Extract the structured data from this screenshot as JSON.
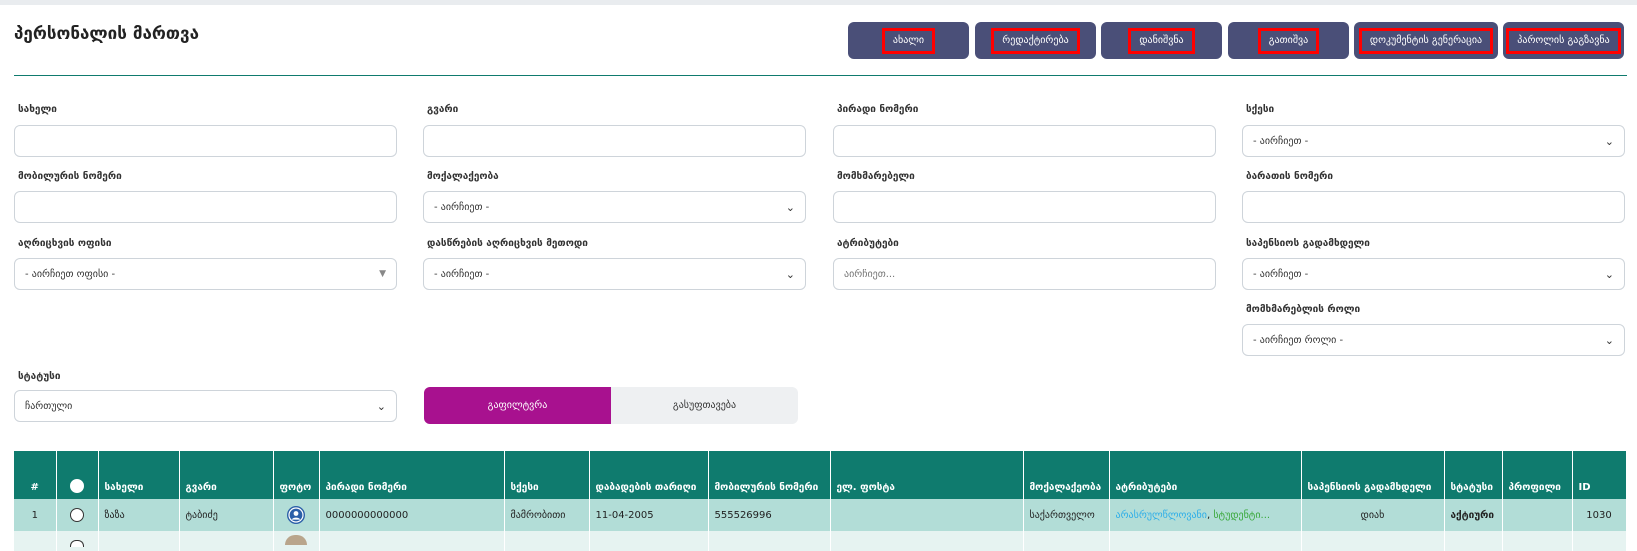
{
  "page_title": "პერსონალის მართვა",
  "actions": {
    "new": "ახალი",
    "edit": "რედაქტირება",
    "assign": "დანიშვნა",
    "dismiss": "გათიშვა",
    "generate_doc": "დოკუმენტის გენერაცია",
    "send_password": "პაროლის გაგზავნა"
  },
  "filters": {
    "name": {
      "label": "სახელი",
      "value": ""
    },
    "surname": {
      "label": "გვარი",
      "value": ""
    },
    "personal_number": {
      "label": "პირადი ნომერი",
      "value": ""
    },
    "gender": {
      "label": "სქესი",
      "selected": "- აირჩიეთ -"
    },
    "mobile": {
      "label": "მობილურის ნომერი",
      "value": ""
    },
    "citizenship": {
      "label": "მოქალაქეობა",
      "selected": "- აირჩიეთ -"
    },
    "user": {
      "label": "მომხმარებელი",
      "value": ""
    },
    "card_number": {
      "label": "ბარათის ნომერი",
      "value": ""
    },
    "office": {
      "label": "აღრიცხვის ოფისი",
      "selected": "- აირჩიეთ ოფისი -"
    },
    "attendance_method": {
      "label": "დასწრების აღრიცხვის მეთოდი",
      "selected": "- აირჩიეთ -"
    },
    "attributes": {
      "label": "ატრიბუტები",
      "placeholder": "აირჩიეთ..."
    },
    "pension_payer": {
      "label": "საპენსიოს გადამხდელი",
      "selected": "- აირჩიეთ -"
    },
    "user_role": {
      "label": "მომხმარებლის როლი",
      "selected": "- აირჩიეთ როლი -"
    },
    "status": {
      "label": "სტატუსი",
      "selected": "ჩართული"
    }
  },
  "buttons": {
    "filter": "გაფილტვრა",
    "clear": "გასუფთავება"
  },
  "table": {
    "headers": [
      "#",
      "",
      "სახელი",
      "გვარი",
      "ფოტო",
      "პირადი ნომერი",
      "სქესი",
      "დაბადების თარიღი",
      "მობილურის ნომერი",
      "ელ. ფოსტა",
      "მოქალაქეობა",
      "ატრიბუტები",
      "საპენსიოს გადამხდელი",
      "სტატუსი",
      "პროფილი",
      "ID"
    ],
    "rows": [
      {
        "index": "1",
        "first_name": "ზაზა",
        "last_name": "ტაბიძე",
        "personal_number": "0000000000000",
        "gender": "მამრობითი",
        "birth_date": "11-04-2005",
        "mobile": "555526996",
        "email": "",
        "citizenship": "საქართველო",
        "attribute_1": "არასრულწლოვანი",
        "attribute_sep": ", ",
        "attribute_2": "სტუდენტი...",
        "pension_payer": "დიახ",
        "status": "აქტიური",
        "profile": "",
        "id": "1030"
      }
    ]
  },
  "colors": {
    "primary_button": "#4a4f78",
    "teal": "#0f7b6e",
    "filter_button": "#a8118f",
    "highlight": "#ff0000"
  }
}
